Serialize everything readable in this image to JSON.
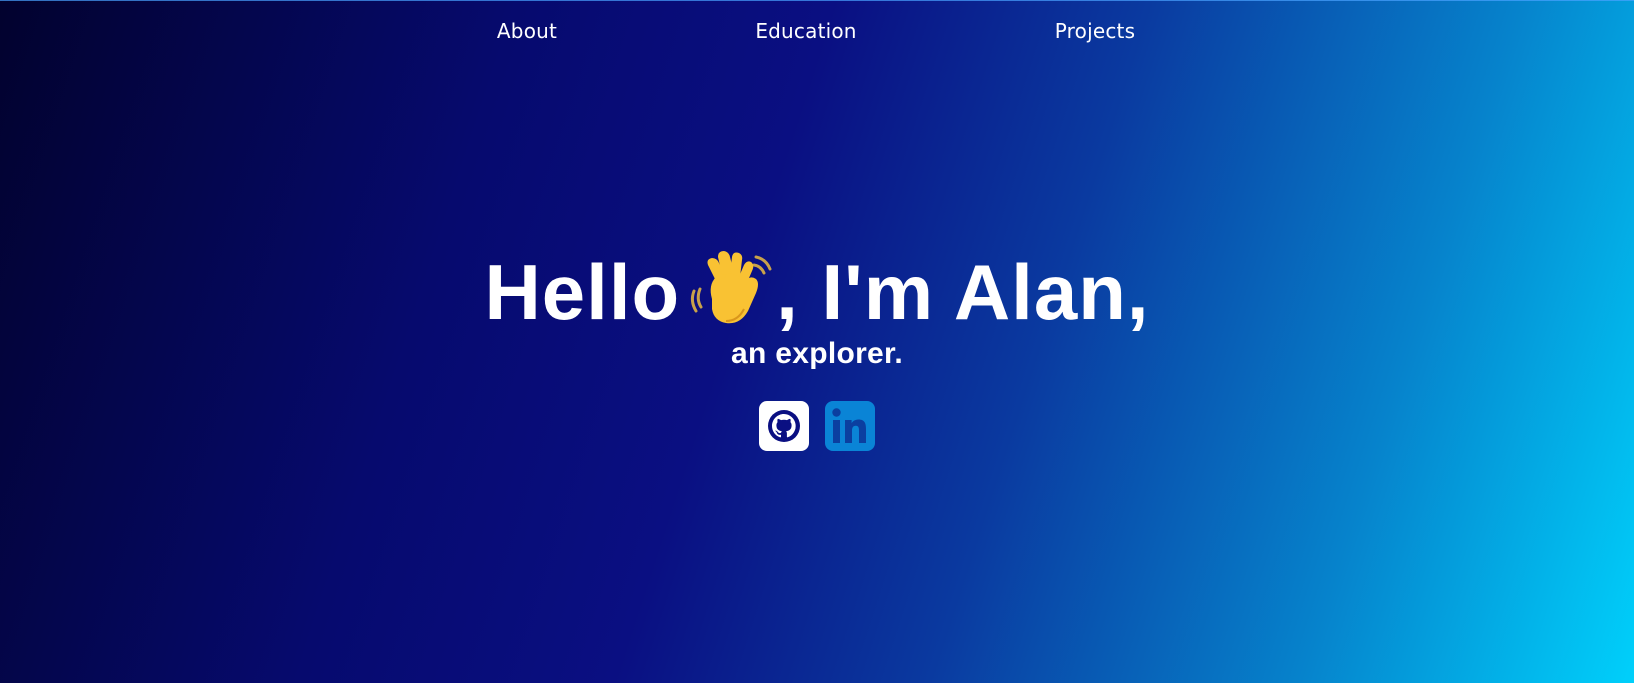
{
  "nav": {
    "items": [
      {
        "label": "About"
      },
      {
        "label": "Education"
      },
      {
        "label": "Projects"
      }
    ]
  },
  "hero": {
    "greeting_start": "Hello",
    "greeting_end": ", I'm Alan,",
    "wave_icon": "waving-hand-emoji",
    "subtitle": "an explorer."
  },
  "socials": [
    {
      "icon": "github-icon",
      "color": "#ffffff"
    },
    {
      "icon": "linkedin-icon",
      "color": "#0a84d6"
    }
  ],
  "colors": {
    "gradient_dark": "#02022e",
    "gradient_mid": "#0a0f82",
    "gradient_light": "#00d0fb",
    "text": "#ffffff"
  }
}
